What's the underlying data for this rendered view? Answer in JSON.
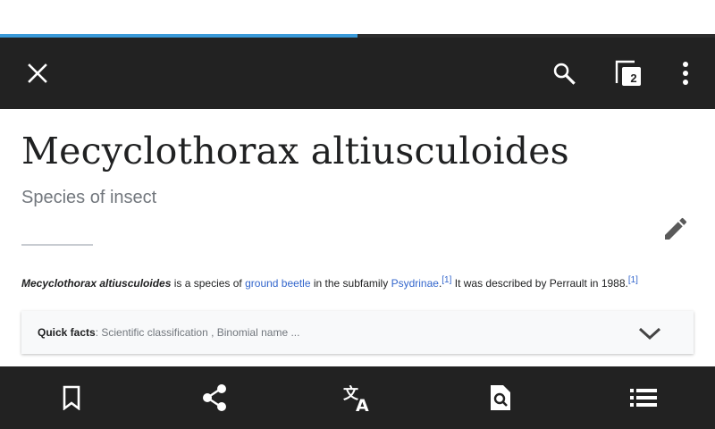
{
  "page_load_progress": 0.5,
  "toolbar": {
    "close_icon": "close-icon",
    "search_icon": "search-icon",
    "tabs_icon": "tabs-icon",
    "tab_count": "2",
    "overflow_icon": "more-vert-icon"
  },
  "article": {
    "title": "Mecyclothorax altiusculoides",
    "description": "Species of insect",
    "edit_icon": "pencil-icon",
    "intro": {
      "subject": "Mecyclothorax altiusculoides",
      "text_1": " is a species of ",
      "link_1": "ground beetle",
      "text_2": " in the subfamily ",
      "link_2": "Psydrinae",
      "text_3": ".",
      "ref_1": "[1]",
      "text_4": " It was described by Perrault in 1988.",
      "ref_2": "[1]"
    },
    "quick_facts": {
      "label": "Quick facts",
      "separator": ": ",
      "summary": "Scientific classification , Binomial name ...",
      "chevron_icon": "chevron-down-icon"
    }
  },
  "bottom_bar": [
    {
      "icon": "bookmark-icon",
      "name": "Save"
    },
    {
      "icon": "share-icon",
      "name": "Share"
    },
    {
      "icon": "translate-icon",
      "name": "Language"
    },
    {
      "icon": "find-in-page-icon",
      "name": "Find in page"
    },
    {
      "icon": "contents-icon",
      "name": "Contents"
    }
  ],
  "colors": {
    "toolbar_bg": "#222222",
    "progress": "#3a9ad9",
    "link": "#3366cc",
    "text": "#202122",
    "muted": "#72777d"
  }
}
